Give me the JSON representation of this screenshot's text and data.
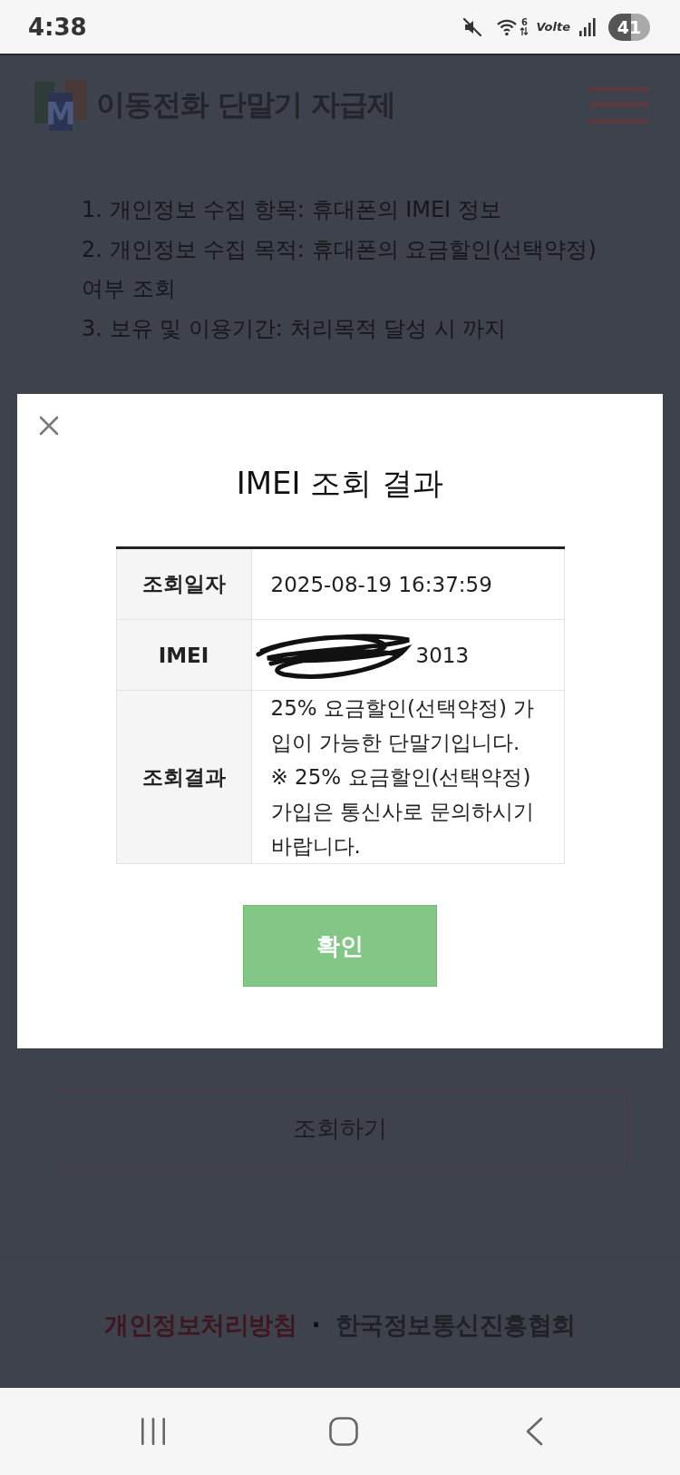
{
  "status_bar": {
    "time": "4:38",
    "wifi_badge": "6",
    "network_label": "Volte",
    "battery": "41"
  },
  "header": {
    "logo_letter": "M",
    "title": "이동전화 단말기 자급제"
  },
  "notice_items": [
    "1. 개인정보 수집 항목: 휴대폰의 IMEI 정보",
    "2. 개인정보 수집 목적: 휴대폰의 요금할인(선택약정) 여부 조회",
    "3. 보유 및 이용기간: 처리목적 달성 시 까지"
  ],
  "search_button": "조회하기",
  "footer": {
    "separator": "·",
    "links": [
      {
        "label": "개인정보처리방침",
        "kind": "highlight"
      },
      {
        "label": "한국정보통신진흥협회",
        "kind": "plain"
      }
    ]
  },
  "modal": {
    "title": "IMEI 조회 결과",
    "rows": [
      {
        "label": "조회일자",
        "value": "2025-08-19 16:37:59",
        "redacted": false
      },
      {
        "label": "IMEI",
        "value": "3013",
        "redacted": true
      },
      {
        "label": "조회결과",
        "value": "25% 요금할인(선택약정) 가입이 가능한 단말기입니다.\n※ 25% 요금할인(선택약정) 가입은 통신사로 문의하시기 바랍니다.",
        "redacted": false
      }
    ],
    "confirm_button": "확인"
  }
}
